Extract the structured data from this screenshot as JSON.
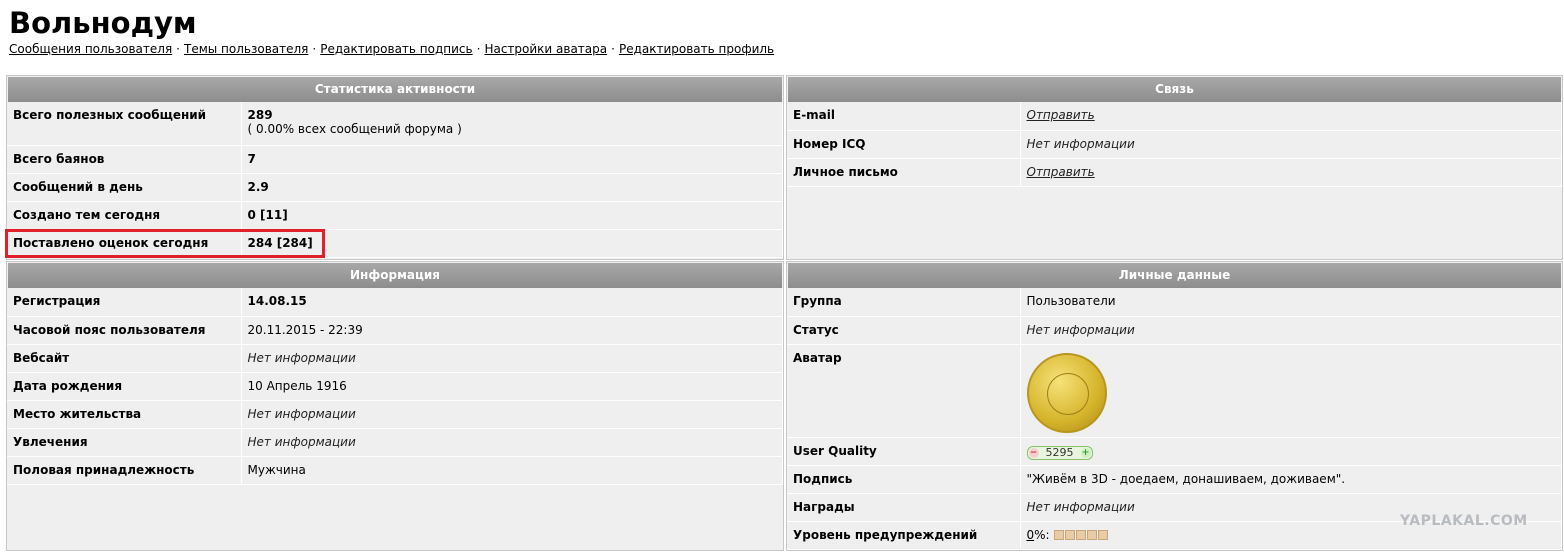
{
  "title": "Вольнодум",
  "nav": [
    "Сообщения пользователя",
    "Темы пользователя",
    "Редактировать подпись",
    "Настройки аватара",
    "Редактировать профиль"
  ],
  "nav_separator": "·",
  "activity": {
    "header": "Статистика активности",
    "rows": [
      {
        "label": "Всего полезных сообщений",
        "value": "289",
        "sub": "( 0.00% всех сообщений форума )"
      },
      {
        "label": "Всего баянов",
        "value": "7"
      },
      {
        "label": "Сообщений в день",
        "value": "2.9"
      },
      {
        "label": "Создано тем сегодня",
        "value": "0 [11]"
      },
      {
        "label": "Поставлено оценок сегодня",
        "value": "284 [284]"
      }
    ]
  },
  "contact": {
    "header": "Связь",
    "rows": [
      {
        "label": "E-mail",
        "value": "Отправить"
      },
      {
        "label": "Номер ICQ",
        "value": "Нет информации"
      },
      {
        "label": "Личное письмо",
        "value": "Отправить"
      }
    ]
  },
  "info": {
    "header": "Информация",
    "rows": [
      {
        "label": "Регистрация",
        "value": "14.08.15"
      },
      {
        "label": "Часовой пояс пользователя",
        "value": "20.11.2015 - 22:39"
      },
      {
        "label": "Вебсайт",
        "value": "Нет информации"
      },
      {
        "label": "Дата рождения",
        "value": "10 Апрель 1916"
      },
      {
        "label": "Место жительства",
        "value": "Нет информации"
      },
      {
        "label": "Увлечения",
        "value": "Нет информации"
      },
      {
        "label": "Половая принадлежность",
        "value": "Мужчина"
      }
    ]
  },
  "personal": {
    "header": "Личные данные",
    "rows": [
      {
        "label": "Группа",
        "value": "Пользователи"
      },
      {
        "label": "Статус",
        "value": "Нет информации"
      },
      {
        "label": "Аватар",
        "avatar_icon": "coin-medal-icon"
      },
      {
        "label": "User Quality",
        "minus": "−",
        "value": "5295",
        "plus": "+"
      },
      {
        "label": "Подпись",
        "value": "\"Живём в 3D - доедаем, донашиваем, доживаем\"."
      },
      {
        "label": "Награды",
        "value": "Нет информации"
      },
      {
        "label": "Уровень предупреждений",
        "percent": "0",
        "suffix": "%:",
        "warning_level": 0,
        "warning_max": 5
      }
    ]
  },
  "watermark": "YAPLAKAL.COM",
  "colors": {
    "panel_bg": "#efefef",
    "header_bg": "#999999",
    "highlight": "#e0202a"
  }
}
